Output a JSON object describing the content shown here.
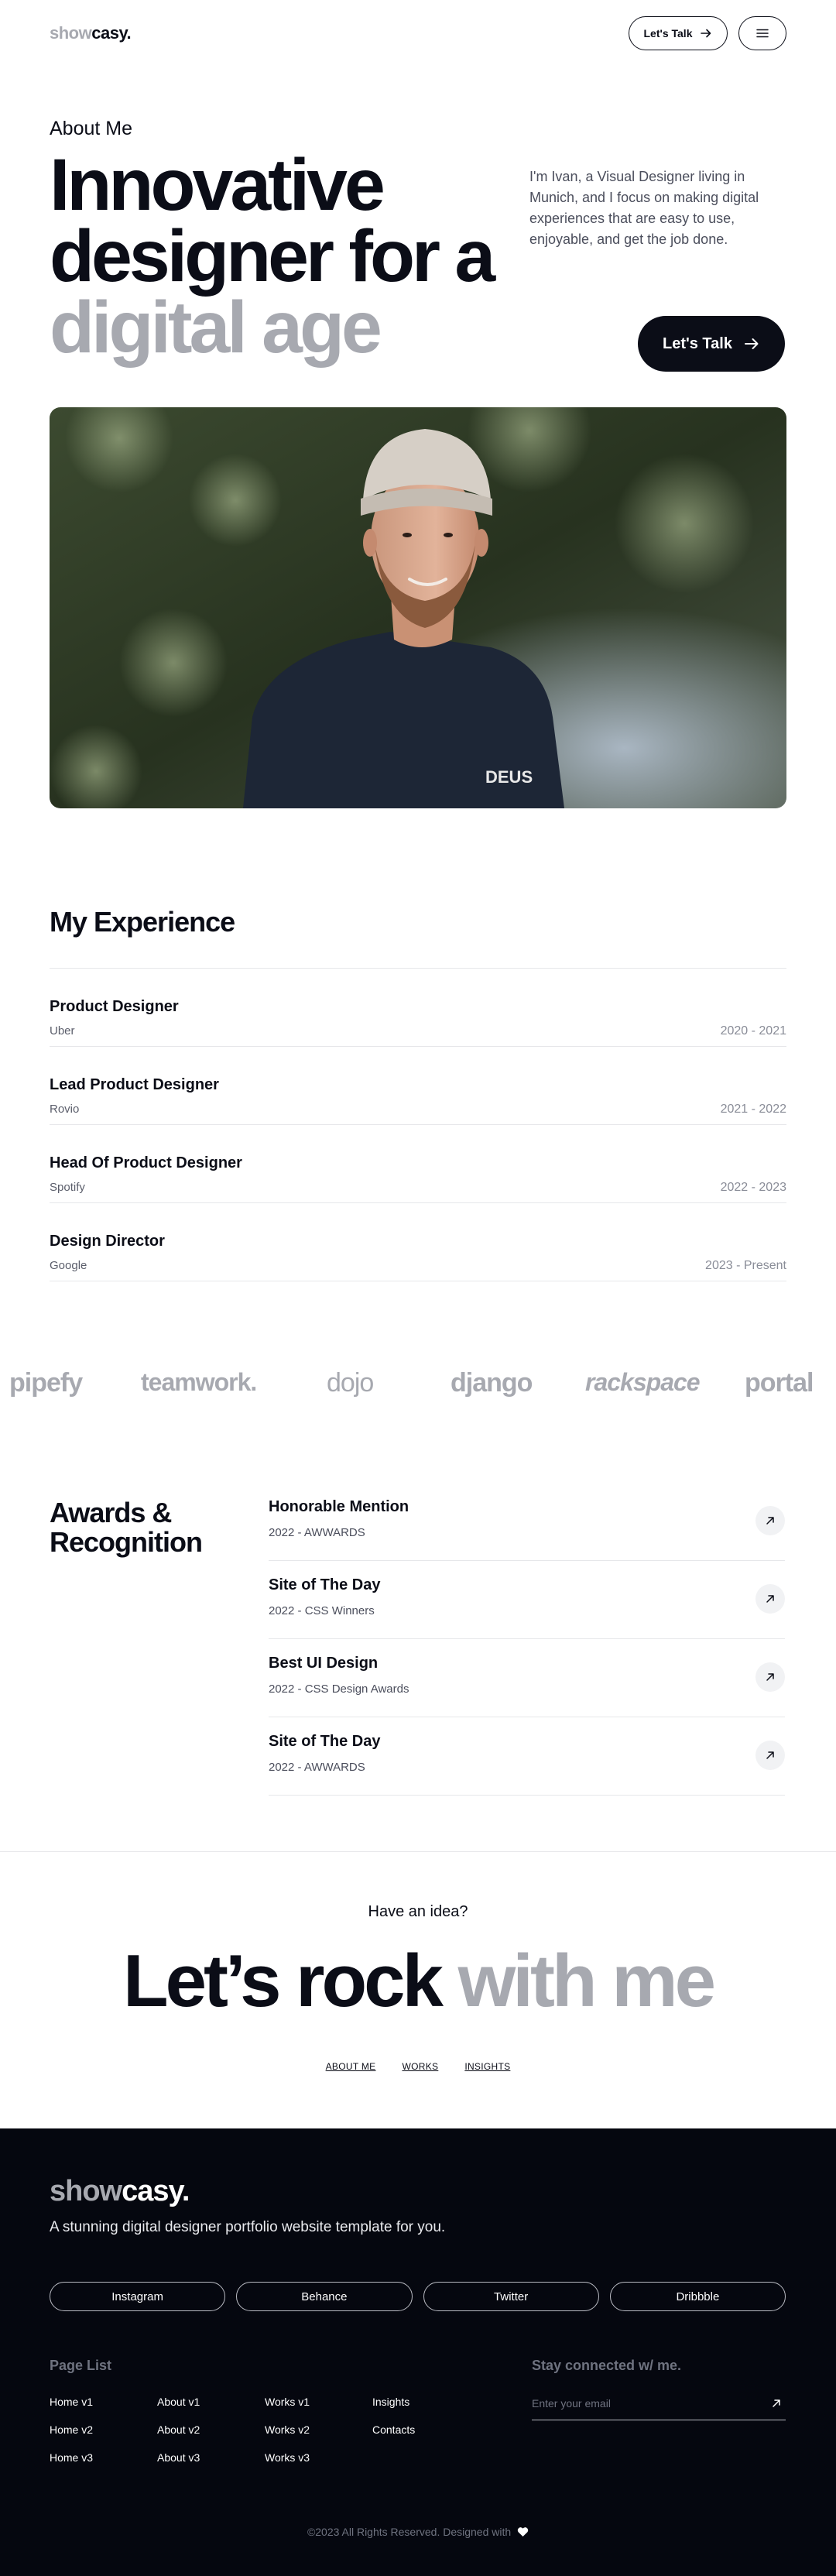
{
  "header": {
    "logo_light": "show",
    "logo_dark": "casy.",
    "talk_label": "Let's Talk",
    "menu_icon": "menu-icon"
  },
  "hero": {
    "eyebrow": "About Me",
    "title_line1": "Innovative",
    "title_line2": "designer for a",
    "title_line3": "digital age",
    "description": "I'm Ivan, a Visual Designer living in Munich, and I focus on making digital experiences that are easy to use, enjoyable, and get the job done.",
    "cta_label": "Let's Talk"
  },
  "photo": {
    "shirt_text": "DEUS"
  },
  "experience": {
    "title": "My Experience",
    "items": [
      {
        "role": "Product Designer",
        "company": "Uber",
        "years": "2020 - 2021"
      },
      {
        "role": "Lead Product Designer",
        "company": "Rovio",
        "years": "2021 - 2022"
      },
      {
        "role": "Head Of Product Designer",
        "company": "Spotify",
        "years": "2022 - 2023"
      },
      {
        "role": "Design Director",
        "company": "Google",
        "years": "2023 - Present"
      }
    ]
  },
  "brands": [
    "pipefy",
    "teamwork.",
    "dojo",
    "django",
    "rackspace",
    "portal"
  ],
  "awards": {
    "title_line1": "Awards &",
    "title_line2": "Recognition",
    "items": [
      {
        "name": "Honorable Mention",
        "meta": "2022 - AWWARDS"
      },
      {
        "name": "Site of The Day",
        "meta": "2022 - CSS Winners"
      },
      {
        "name": "Best UI Design",
        "meta": "2022 - CSS Design Awards"
      },
      {
        "name": "Site of The Day",
        "meta": "2022 - AWWARDS"
      }
    ]
  },
  "cta": {
    "eyebrow": "Have an idea?",
    "title_dark": "Let’s rock",
    "title_grey": "with me",
    "links": [
      "ABOUT ME",
      "WORKS",
      "INSIGHTS"
    ]
  },
  "footer": {
    "logo_light": "show",
    "logo_dark": "casy.",
    "tagline": "A stunning digital designer portfolio website template for you.",
    "socials": [
      "Instagram",
      "Behance",
      "Twitter",
      "Dribbble"
    ],
    "page_list_title": "Page List",
    "page_columns": [
      [
        "Home v1",
        "Home v2",
        "Home v3"
      ],
      [
        "About v1",
        "About v2",
        "About v3"
      ],
      [
        "Works v1",
        "Works v2",
        "Works v3"
      ],
      [
        "Insights",
        "Contacts"
      ]
    ],
    "newsletter_title": "Stay connected w/ me.",
    "email_placeholder": "Enter your email",
    "copyright": "©2023 All Rights Reserved. Designed with"
  },
  "colors": {
    "dark": "#0b0d17",
    "grey_text": "#a7a9b0",
    "footer_bg": "#05070f",
    "divider": "#e6e7ea"
  }
}
